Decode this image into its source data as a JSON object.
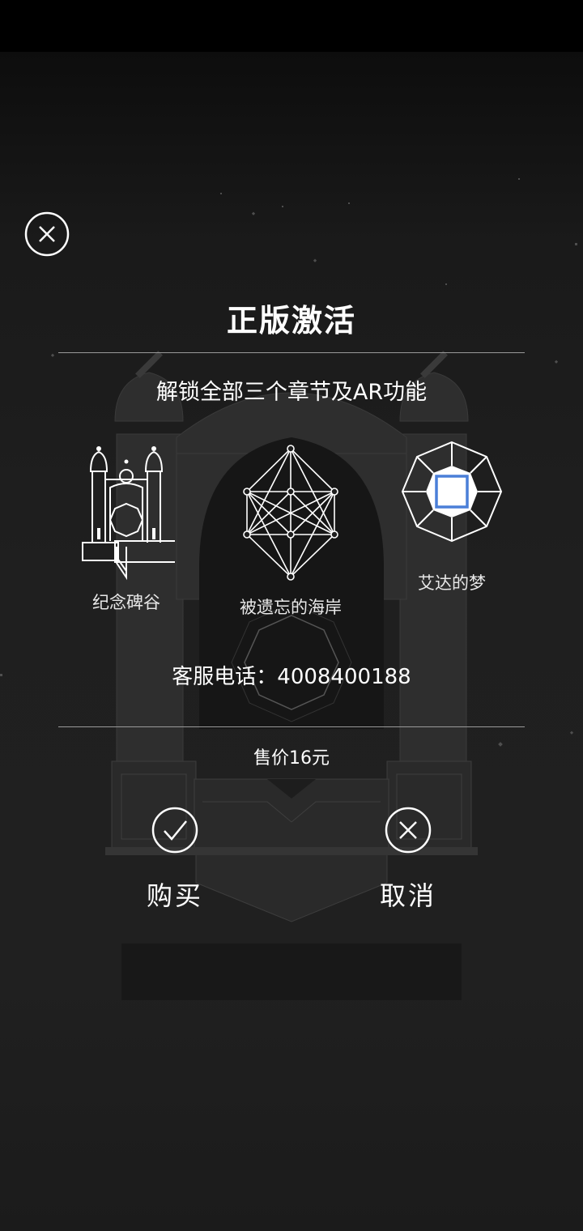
{
  "dialog": {
    "title": "正版激活",
    "subtitle": "解锁全部三个章节及AR功能",
    "chapters": [
      {
        "label": "纪念碑谷",
        "icon": "monument-temple-icon"
      },
      {
        "label": "被遗忘的海岸",
        "icon": "sacred-geometry-icon"
      },
      {
        "label": "艾达的梦",
        "icon": "octagon-square-icon"
      }
    ],
    "service_phone": "客服电话：4008400188",
    "price": "售价16元",
    "buy_label": "购买",
    "cancel_label": "取消"
  },
  "colors": {
    "background": "#1e1e1e",
    "text": "#ffffff",
    "divider": "#9a9a9a",
    "accent_square": "#4a7fd8"
  }
}
